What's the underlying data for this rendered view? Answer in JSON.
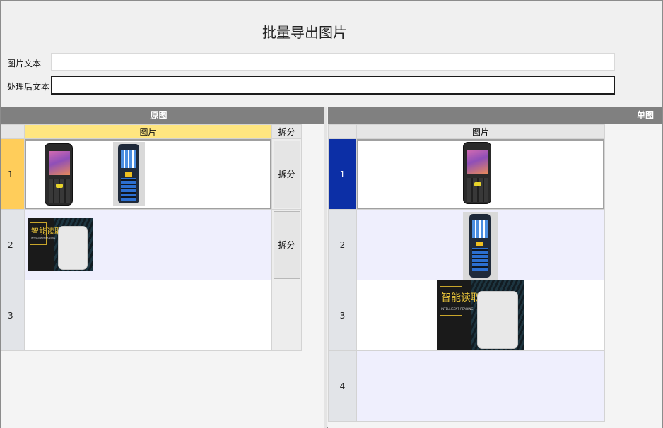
{
  "window": {
    "title": "批量导出图片"
  },
  "form": {
    "image_text_label": "图片文本",
    "image_text_value": "",
    "processed_text_label": "处理后文本",
    "processed_text_value": ""
  },
  "left_panel": {
    "header": "原图",
    "columns": [
      "图片",
      "拆分"
    ],
    "rows": [
      {
        "num": "1",
        "images": [
          "android-handheld-terminal",
          "barcode-scanner-terminal"
        ],
        "button": "拆分"
      },
      {
        "num": "2",
        "images": [
          "smart-reader-banner"
        ],
        "button": "拆分"
      },
      {
        "num": "3",
        "images": [],
        "button": ""
      }
    ]
  },
  "right_panel": {
    "header": "单图",
    "columns": [
      "图片"
    ],
    "rows": [
      {
        "num": "1",
        "image": "android-handheld-terminal"
      },
      {
        "num": "2",
        "image": "barcode-scanner-terminal"
      },
      {
        "num": "3",
        "image": "smart-reader-banner"
      },
      {
        "num": "4",
        "image": ""
      }
    ]
  },
  "banner_text": {
    "logo": "智能读取",
    "sub": "INTELLIGENT READING"
  },
  "colors": {
    "header": "#808080",
    "active_yellow": "#ffcd5a",
    "active_blue": "#0c2fa6",
    "row_alt": "#efeffd"
  }
}
